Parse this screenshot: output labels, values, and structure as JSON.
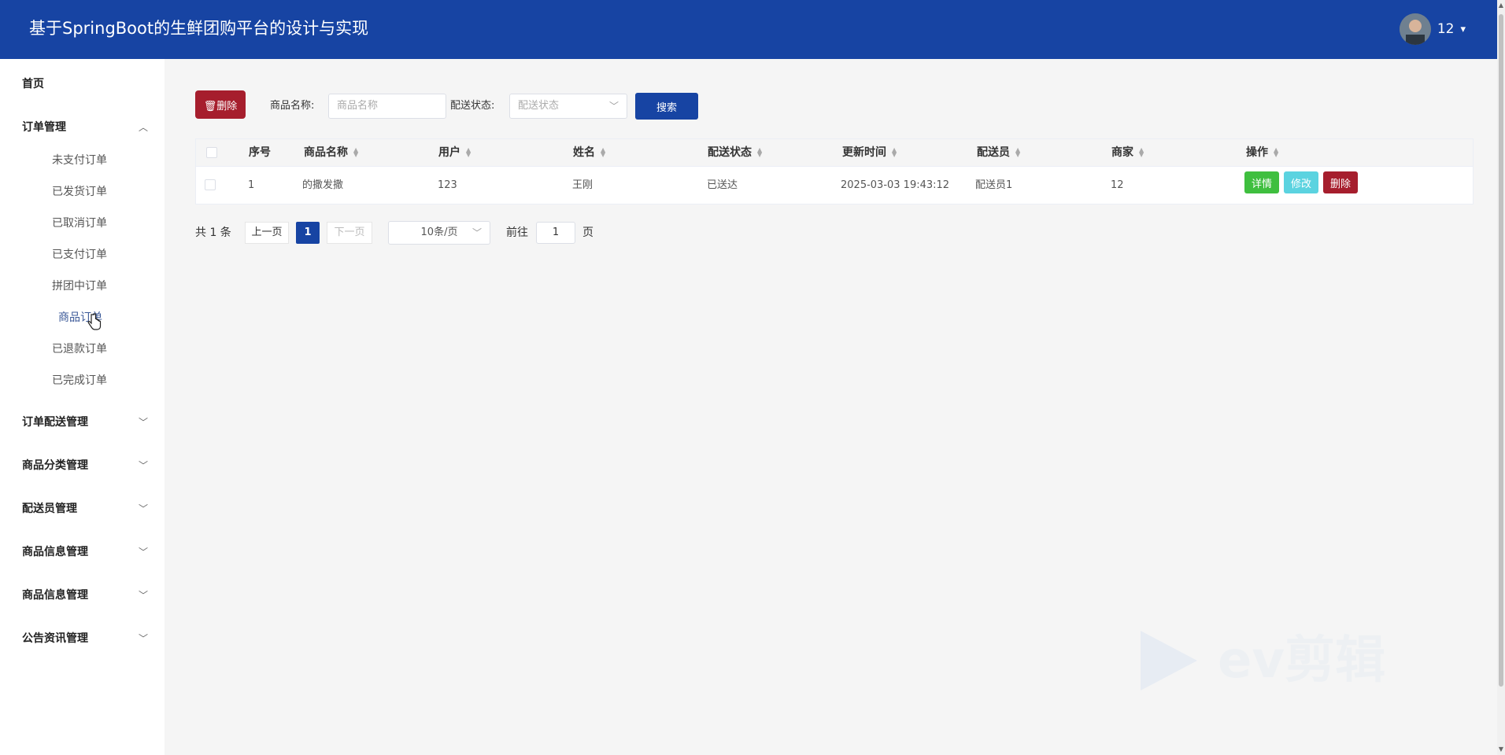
{
  "header": {
    "title": "基于SpringBoot的生鲜团购平台的设计与实现",
    "username": "12"
  },
  "sidebar": {
    "home": "首页",
    "order_mgmt": {
      "label": "订单管理",
      "items": [
        "未支付订单",
        "已发货订单",
        "已取消订单",
        "已支付订单",
        "拼团中订单",
        "商品订单",
        "已退款订单",
        "已完成订单"
      ]
    },
    "groups": [
      "订单配送管理",
      "商品分类管理",
      "配送员管理",
      "商品信息管理",
      "商品信息管理",
      "公告资讯管理"
    ]
  },
  "toolbar": {
    "delete_label": "删除",
    "name_label": "商品名称:",
    "name_placeholder": "商品名称",
    "status_label": "配送状态:",
    "status_placeholder": "配送状态",
    "search_label": "搜索"
  },
  "table": {
    "columns": [
      "序号",
      "商品名称",
      "用户",
      "姓名",
      "配送状态",
      "更新时间",
      "配送员",
      "商家",
      "操作"
    ],
    "rows": [
      {
        "no": "1",
        "name": "的撒发撒",
        "user": "123",
        "realname": "王刚",
        "status": "已送达",
        "time": "2025-03-03 19:43:12",
        "courier": "配送员1",
        "merchant": "12"
      }
    ],
    "actions": {
      "detail": "详情",
      "edit": "修改",
      "delete": "删除"
    }
  },
  "pagination": {
    "total": "共 1 条",
    "prev": "上一页",
    "current": "1",
    "next": "下一页",
    "page_size": "10条/页",
    "goto_label": "前往",
    "goto_value": "1",
    "page_suffix": "页"
  },
  "watermark": "ev剪辑",
  "colors": {
    "header": "#1744a3",
    "danger": "#a61e2d",
    "success": "#3fbf3f",
    "info": "#5bd3e0"
  }
}
